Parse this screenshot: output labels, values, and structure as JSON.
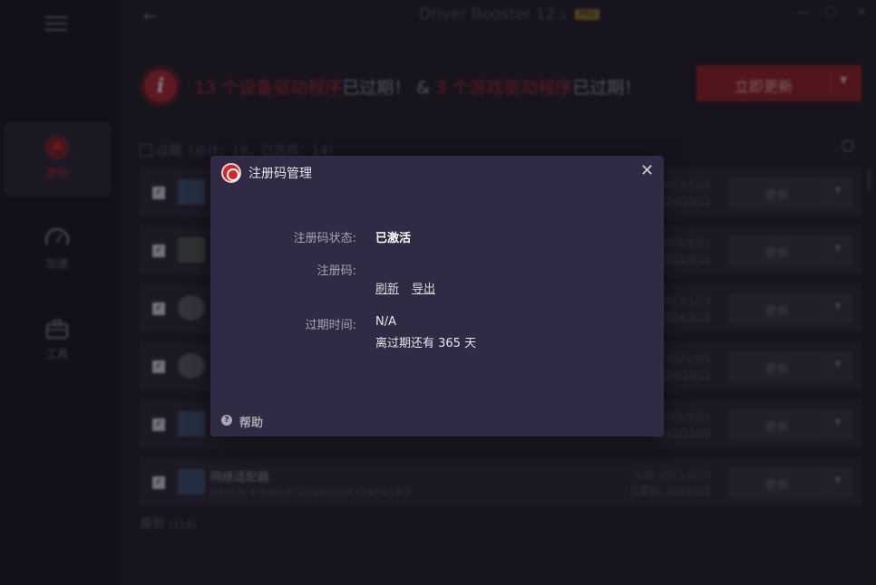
{
  "app": {
    "title": "Driver Booster 12.",
    "title_suffix": "1",
    "badge": "PRO",
    "back_glyph": "←",
    "minimize_glyph": "—",
    "maximize_glyph": "☐",
    "close_glyph": "✕"
  },
  "sidebar": {
    "items": [
      {
        "label": "更新",
        "icon": "refresh-icon",
        "active": true
      },
      {
        "label": "加速",
        "icon": "speedometer-icon",
        "active": false
      },
      {
        "label": "工具",
        "icon": "toolbox-icon",
        "active": false
      }
    ]
  },
  "summary": {
    "device_count": "13",
    "device_text": " 个设备驱动程序",
    "expired_text": "已过期！",
    "amp": " & ",
    "game_count": "3",
    "game_text": " 个游戏驱动程序",
    "expired_text2": "已过期！",
    "update_button": "立即更新"
  },
  "list": {
    "outdated_header": "过期（总计：16，已选择：14）",
    "latest_label": "最新",
    "latest_count": "(119)",
    "rows": [
      {
        "name": "",
        "sub": "",
        "current": "2023/12/6",
        "available": "2024/10/15",
        "button": "更新"
      },
      {
        "name": "",
        "sub": "",
        "current": "2006/6/21",
        "available": "2023/4/12",
        "button": "更新"
      },
      {
        "name": "",
        "sub": "",
        "current": "2023/1/19",
        "available": "2024/3/28",
        "button": "更新"
      },
      {
        "name": "",
        "sub": "",
        "current": "2022/9/9",
        "available": "2024/10/15",
        "button": "更新"
      },
      {
        "name": "",
        "sub": "",
        "current": "2006/6/21",
        "available": "2021/11/20",
        "button": "更新"
      },
      {
        "name": "网络适配器",
        "sub": "Intel(R) Ethernet Connection (14) I219-V",
        "current": "当前: 2021/2/10",
        "available": "可更新: 2024/5/5",
        "button": "更新"
      }
    ]
  },
  "dialog": {
    "title": "注册码管理",
    "close_glyph": "✕",
    "status_label": "注册码状态:",
    "status_value": "已激活",
    "code_label": "注册码:",
    "refresh_link": "刷新",
    "export_link": "导出",
    "expiry_label": "过期时间:",
    "expiry_value": "N/A",
    "days_left": "离过期还有 365 天",
    "help_label": "帮助",
    "help_glyph": "?"
  }
}
